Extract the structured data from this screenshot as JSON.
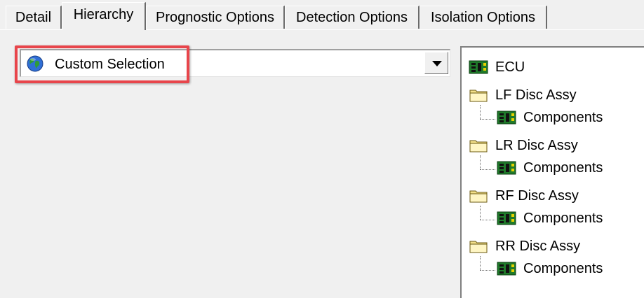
{
  "tabs": [
    {
      "label": "Detail",
      "active": false
    },
    {
      "label": "Hierarchy",
      "active": true
    },
    {
      "label": "Prognostic Options",
      "active": false
    },
    {
      "label": "Detection Options",
      "active": false
    },
    {
      "label": "Isolation Options",
      "active": false
    }
  ],
  "selector": {
    "value": "Custom Selection",
    "icon": "globe-icon"
  },
  "highlight_color": "#e8454b",
  "tree": {
    "root": {
      "label": "ECU",
      "icon": "circuit-board-icon"
    },
    "assemblies": [
      {
        "label": "LF Disc Assy",
        "icon": "folder-icon",
        "child": {
          "label": "Components",
          "icon": "circuit-board-icon"
        }
      },
      {
        "label": "LR Disc Assy",
        "icon": "folder-icon",
        "child": {
          "label": "Components",
          "icon": "circuit-board-icon"
        }
      },
      {
        "label": "RF Disc Assy",
        "icon": "folder-icon",
        "child": {
          "label": "Components",
          "icon": "circuit-board-icon"
        }
      },
      {
        "label": "RR Disc Assy",
        "icon": "folder-icon",
        "child": {
          "label": "Components",
          "icon": "circuit-board-icon"
        }
      }
    ]
  }
}
